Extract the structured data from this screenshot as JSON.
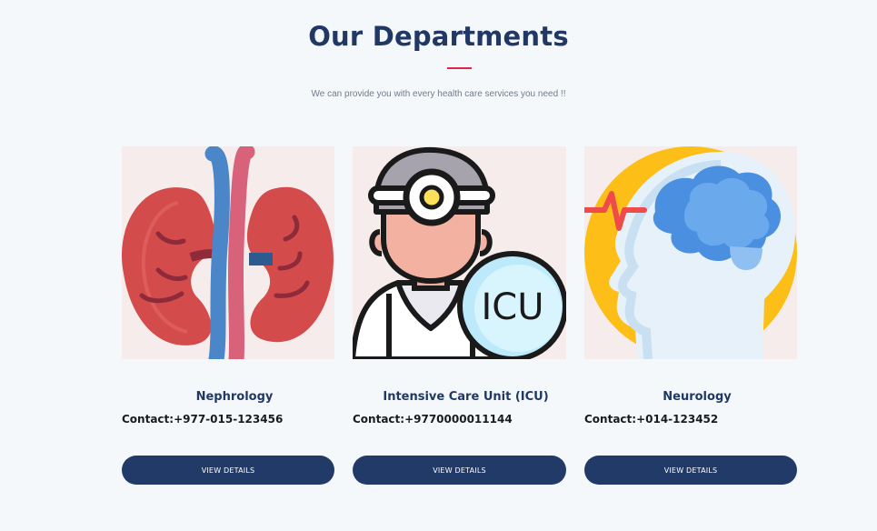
{
  "section": {
    "title": "Our Departments",
    "subtitle": "We can provide you with every health care services you need !!"
  },
  "departments": [
    {
      "name": "Nephrology",
      "contact": "Contact:+977-015-123456",
      "button_label": "VIEW DETAILS",
      "image_icon": "kidneys-icon"
    },
    {
      "name": "Intensive Care Unit (ICU)",
      "contact": "Contact:+9770000011144",
      "button_label": "VIEW DETAILS",
      "image_icon": "doctor-icu-icon",
      "image_text": "ICU"
    },
    {
      "name": "Neurology",
      "contact": "Contact:+014-123452",
      "button_label": "VIEW DETAILS",
      "image_icon": "brain-head-icon"
    }
  ],
  "colors": {
    "background": "#f4f8fb",
    "heading": "#213865",
    "accent": "#e2254f",
    "button": "#223a68",
    "card_image_bg": "#f6ecec"
  }
}
